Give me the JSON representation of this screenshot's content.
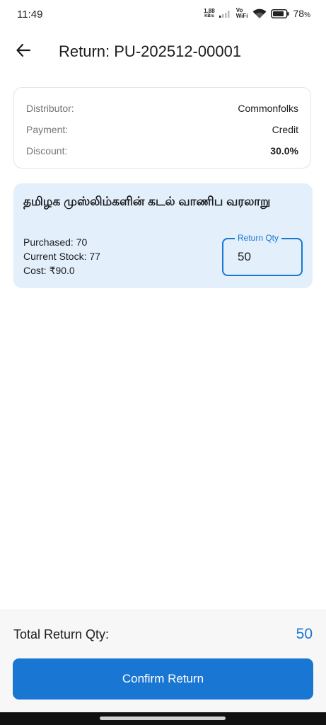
{
  "status_bar": {
    "time": "11:49",
    "net_speed_value": "1.88",
    "net_speed_unit": "KB/s",
    "volte_top": "Vo",
    "volte_bottom": "WiFi",
    "battery_percent": "78",
    "battery_symbol": "%"
  },
  "app_bar": {
    "title": "Return: PU-202512-00001",
    "back_icon": "arrow-left-icon"
  },
  "info": {
    "distributor_label": "Distributor:",
    "distributor_value": "Commonfolks",
    "payment_label": "Payment:",
    "payment_value": "Credit",
    "discount_label": "Discount:",
    "discount_value": "30.0%"
  },
  "item": {
    "title": "தமிழக முஸ்லிம்களின் கடல் வாணிப வரலாறு",
    "purchased": "Purchased: 70",
    "current_stock": "Current Stock: 77",
    "cost": "Cost: ₹90.0",
    "return_qty_label": "Return Qty",
    "return_qty_value": "50"
  },
  "footer": {
    "total_label": "Total Return Qty:",
    "total_value": "50",
    "confirm_label": "Confirm Return"
  },
  "colors": {
    "accent": "#1976d2",
    "card_bg": "#e3f0fb"
  }
}
